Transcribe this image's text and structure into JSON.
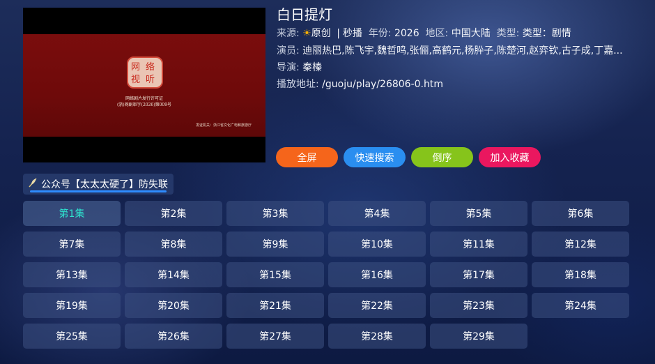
{
  "player": {
    "license_line1": "网络剧片发行许可证",
    "license_line2": "(浙)网剧审字(2026)第009号",
    "issuer": "发证机关：浙江省文化广电和旅游厅",
    "seal_text": "网络视听"
  },
  "details": {
    "title": "白日提灯",
    "source_label": "来源:",
    "source_icon": "sun-icon",
    "source_value": "原创",
    "source_sep": "|",
    "source_extra": "秒播",
    "year_label": "年份:",
    "year_value": "2026",
    "region_label": "地区:",
    "region_value": "中国大陆",
    "type_label": "类型:",
    "type_value": "类型：剧情",
    "cast_label": "演员:",
    "cast_value": "迪丽热巴,陈飞宇,魏哲鸣,张俪,高鹤元,杨肸子,陈楚河,赵弈钦,古子成,丁嘉...",
    "director_label": "导演:",
    "director_value": "秦榛",
    "url_label": "播放地址:",
    "url_value": "/guoju/play/26806-0.htm"
  },
  "actions": {
    "fullscreen": "全屏",
    "quick_search": "快速搜索",
    "reverse": "倒序",
    "favorite": "加入收藏"
  },
  "notice": {
    "text": "公众号【太太太硬了】防失联",
    "icon": "feather-icon"
  },
  "episodes": [
    "第1集",
    "第2集",
    "第3集",
    "第4集",
    "第5集",
    "第6集",
    "第7集",
    "第8集",
    "第9集",
    "第10集",
    "第11集",
    "第12集",
    "第13集",
    "第14集",
    "第15集",
    "第16集",
    "第17集",
    "第18集",
    "第19集",
    "第20集",
    "第21集",
    "第22集",
    "第23集",
    "第24集",
    "第25集",
    "第26集",
    "第27集",
    "第28集",
    "第29集"
  ],
  "active_episode_index": 0,
  "colors": {
    "fullscreen": "#f5651b",
    "quick_search": "#2a8ef0",
    "reverse": "#86c41b",
    "favorite": "#ea175f",
    "active_episode_text": "#2ee6d0"
  }
}
